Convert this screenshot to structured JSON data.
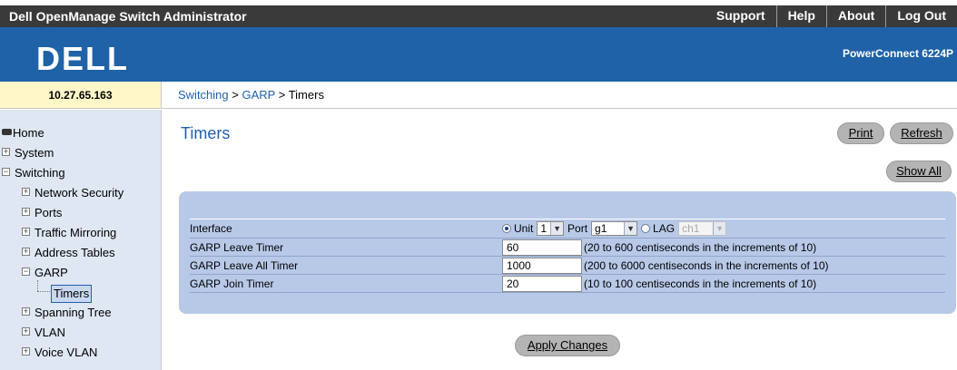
{
  "app": {
    "title": "Dell OpenManage Switch Administrator",
    "links": [
      "Support",
      "Help",
      "About",
      "Log Out"
    ],
    "logo_text": "DELL",
    "model": "PowerConnect 6224P"
  },
  "address": {
    "ip": "10.27.65.163"
  },
  "breadcrumb": {
    "items": [
      "Switching",
      "GARP"
    ],
    "separator": ">",
    "current": "Timers"
  },
  "sidebar": {
    "home": "Home",
    "system": "System",
    "switching": "Switching",
    "network_security": "Network Security",
    "ports": "Ports",
    "traffic_mirroring": "Traffic Mirroring",
    "address_tables": "Address Tables",
    "garp": "GARP",
    "timers": "Timers",
    "spanning_tree": "Spanning Tree",
    "vlan": "VLAN",
    "voice_vlan": "Voice VLAN"
  },
  "main": {
    "title": "Timers",
    "print_label": "Print",
    "refresh_label": "Refresh",
    "show_all_label": "Show All",
    "apply_label": "Apply Changes",
    "interface": {
      "label": "Interface",
      "unit_label": "Unit",
      "unit_value": "1",
      "port_label": "Port",
      "port_value": "g1",
      "lag_label": "LAG",
      "lag_value": "ch1",
      "selected": "Unit"
    },
    "rows": [
      {
        "label": "GARP Leave Timer",
        "value": "60",
        "desc": "(20 to 600 centiseconds in the increments of 10)"
      },
      {
        "label": "GARP Leave All Timer",
        "value": "1000",
        "desc": "(200 to 6000 centiseconds in the increments of 10)"
      },
      {
        "label": "GARP Join Timer",
        "value": "20",
        "desc": "(10 to 100 centiseconds in the increments of 10)"
      }
    ]
  },
  "colors": {
    "banner": "#1f62a8",
    "topbar": "#3a3a3a",
    "sidebar": "#dfe7f3",
    "panel": "#b8c9e8",
    "link": "#1f5fae"
  }
}
